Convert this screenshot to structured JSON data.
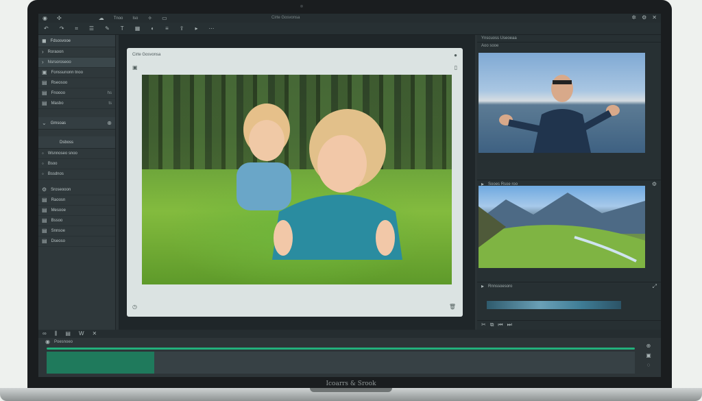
{
  "app": {
    "window_title": "Cirte Gosvonsa",
    "brand": "Icoarrs & Srook",
    "menu": [
      "Tnoo",
      "Iso"
    ]
  },
  "left_panel": {
    "header": "Fdsosvooe",
    "items": [
      {
        "label": "Roraoon"
      },
      {
        "label": "Nsrsoroseoo"
      },
      {
        "label": "Fonssunonn tnoo"
      },
      {
        "label": "Rseosoo"
      },
      {
        "label": "Fnoooo",
        "value": "hs"
      },
      {
        "label": "Masbo",
        "value": "ts"
      }
    ],
    "section_label": "Gmsoas",
    "section2_label": "Dsboss",
    "section2_items": [
      "Wsnnoseo snoo",
      "Bsoo",
      "Bssdnos"
    ],
    "section3_label": "Sroseooon",
    "section3_items": [
      "Raoosn",
      "Mesooe",
      "Bssoo",
      "Snnsoe",
      "Dseoso"
    ]
  },
  "canvas": {
    "card_title": "Cirte Gosvonsa"
  },
  "right_panel": {
    "header": "Ynscuoss  Useoeaa",
    "preview_label": "Aoo sooe",
    "bar1_label": "Sooes Rsoe roo",
    "bar2_label": "Rnnssoesoro"
  },
  "timeline": {
    "label": "Poesnoeo"
  },
  "colors": {
    "accent": "#22b07b",
    "clip": "#1f7a5c"
  }
}
